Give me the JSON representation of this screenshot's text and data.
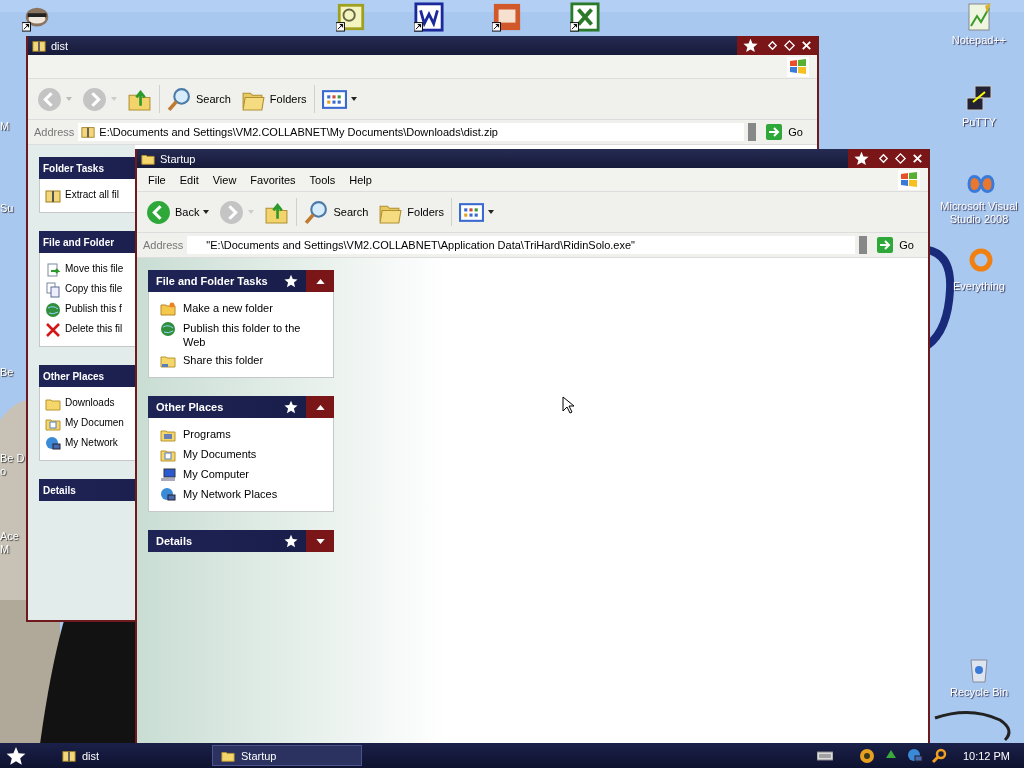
{
  "desktop": {
    "top_icons": [
      {
        "kind": "raccoon"
      },
      {
        "kind": "schedule"
      },
      {
        "kind": "word"
      },
      {
        "kind": "slides"
      },
      {
        "kind": "sheet"
      }
    ],
    "icons": [
      {
        "label": "Notepad++",
        "kind": "notepad"
      },
      {
        "label": "PuTTY",
        "kind": "terminal"
      },
      {
        "label": "Microsoft Visual Studio 2008",
        "kind": "studio"
      },
      {
        "label": "Everything",
        "kind": "ring"
      },
      {
        "label": "Recycle Bin",
        "kind": "bin"
      }
    ],
    "edge_labels": [
      "M",
      "Su",
      "Be",
      "Be Do",
      "AceM"
    ]
  },
  "windows": [
    {
      "title": "dist",
      "toolbar": {
        "back": {
          "disabled": true
        },
        "search": "Search",
        "folders": "Folders"
      },
      "address": {
        "label": "Address",
        "path": "E:\\Documents and Settings\\VM2.COLLABNET\\My Documents\\Downloads\\dist.zip",
        "kind": "zip",
        "go": "Go"
      },
      "panes": [
        {
          "title": "Folder Tasks",
          "expanded": true,
          "items": [
            {
              "label": "Extract all fil",
              "kind": "zip"
            }
          ]
        },
        {
          "title": "File and Folder",
          "expanded": true,
          "items": [
            {
              "label": "Move this file",
              "kind": "move"
            },
            {
              "label": "Copy this file",
              "kind": "copy"
            },
            {
              "label": "Publish this f",
              "kind": "globe"
            },
            {
              "label": "Delete this fil",
              "kind": "delete"
            }
          ]
        },
        {
          "title": "Other Places",
          "expanded": true,
          "items": [
            {
              "label": "Downloads",
              "kind": "folder"
            },
            {
              "label": "My Documen",
              "kind": "documents"
            },
            {
              "label": "My Network",
              "kind": "network"
            }
          ]
        },
        {
          "title": "Details",
          "expanded": false
        }
      ]
    },
    {
      "title": "Startup",
      "menu": [
        "File",
        "Edit",
        "View",
        "Favorites",
        "Tools",
        "Help"
      ],
      "toolbar": {
        "back": {
          "label": "Back",
          "disabled": false
        },
        "search": "Search",
        "folders": "Folders"
      },
      "address": {
        "label": "Address",
        "path": "\"E:\\Documents and Settings\\VM2.COLLABNET\\Application Data\\TriHard\\RidinSolo.exe\"",
        "go": "Go"
      },
      "panes": [
        {
          "title": "File and Folder Tasks",
          "expanded": true,
          "items": [
            {
              "label": "Make a new folder",
              "kind": "newfolder"
            },
            {
              "label": "Publish this folder to the Web",
              "kind": "globe"
            },
            {
              "label": "Share this folder",
              "kind": "share"
            }
          ]
        },
        {
          "title": "Other Places",
          "expanded": true,
          "items": [
            {
              "label": "Programs",
              "kind": "programs"
            },
            {
              "label": "My Documents",
              "kind": "documents"
            },
            {
              "label": "My Computer",
              "kind": "computer"
            },
            {
              "label": "My Network Places",
              "kind": "network"
            }
          ]
        },
        {
          "title": "Details",
          "expanded": false
        }
      ]
    }
  ],
  "taskbar": {
    "buttons": [
      {
        "label": "dist",
        "selected": false
      },
      {
        "label": "Startup",
        "selected": true
      }
    ],
    "clock": "10:12 PM"
  }
}
